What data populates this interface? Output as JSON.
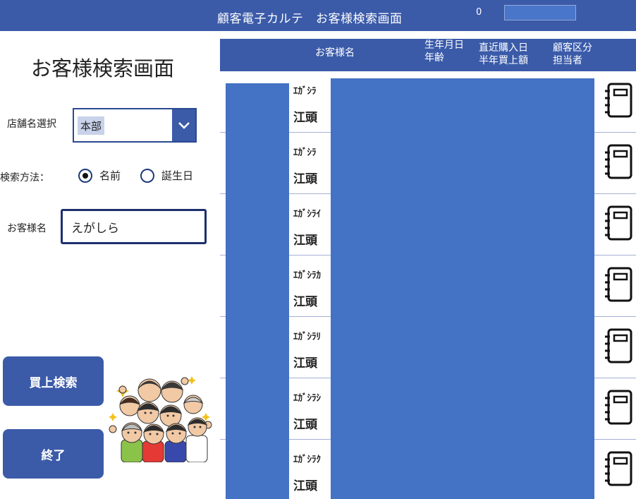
{
  "header": {
    "title": "顧客電子カルテ　お客様検索画面",
    "count": "0",
    "box_value": ""
  },
  "page_title": "お客様検索画面",
  "store": {
    "label": "店舗名選択",
    "value": "本部"
  },
  "search_method": {
    "label": "検索方法：",
    "options": [
      "名前",
      "誕生日"
    ],
    "selected": "名前"
  },
  "customer_name": {
    "label": "お客様名",
    "value": "えがしら"
  },
  "buttons": {
    "search": "買上検索",
    "end": "終了"
  },
  "grid": {
    "columns": {
      "name": "お客様名",
      "birth_line1": "生年月日",
      "birth_line2": "年齢",
      "purchase_line1": "直近購入日",
      "purchase_line2": "半年買上額",
      "class_line1": "顧客区分",
      "class_line2": "担当者"
    },
    "rows": [
      {
        "kana": "ｴｶﾞｼﾗ",
        "kanji": "江頭"
      },
      {
        "kana": "ｴｶﾞｼﾗ",
        "kanji": "江頭"
      },
      {
        "kana": "ｴｶﾞｼﾗｲ",
        "kanji": "江頭"
      },
      {
        "kana": "ｴｶﾞｼﾗｶ",
        "kanji": "江頭"
      },
      {
        "kana": "ｴｶﾞｼﾗﾘ",
        "kanji": "江頭"
      },
      {
        "kana": "ｴｶﾞｼﾗｼ",
        "kanji": "江頭"
      },
      {
        "kana": "ｴｶﾞｼﾗｸ",
        "kanji": "江頭"
      }
    ]
  },
  "icons": {
    "dropdown": "chevron-down-icon",
    "row_action": "notebook-icon",
    "illustration": "cheering-people-illustration"
  },
  "colors": {
    "primary": "#3b5ba9",
    "redacted": "#4472c4",
    "input_border": "#1d2f6f"
  }
}
